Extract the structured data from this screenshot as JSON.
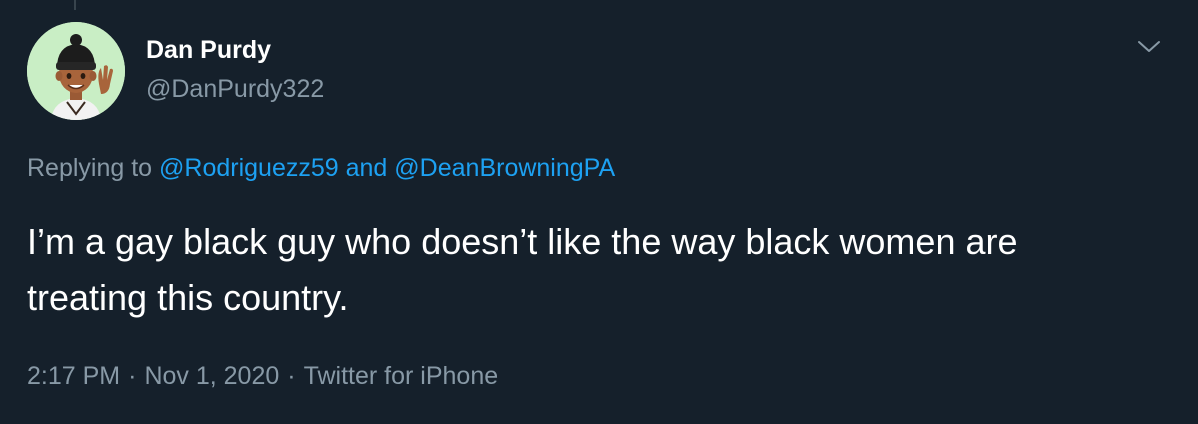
{
  "author": {
    "display_name": "Dan Purdy",
    "handle": "@DanPurdy322",
    "avatar": "memoji-avatar"
  },
  "reply": {
    "prefix": "Replying to",
    "mention_1": "@Rodriguezz59",
    "conjunction": "and",
    "mention_2": "@DeanBrowningPA"
  },
  "tweet": {
    "text": "I’m a gay black guy who doesn’t like the way black women are treating this country."
  },
  "meta": {
    "time": "2:17 PM",
    "separator": "·",
    "date": "Nov 1, 2020",
    "source": "Twitter for iPhone"
  },
  "icons": {
    "more": "chevron-down-icon"
  },
  "colors": {
    "background": "#15202b",
    "text": "#ffffff",
    "secondary_text": "#8899a6",
    "link": "#1da1f2",
    "avatar_bg": "#c9eec5"
  }
}
